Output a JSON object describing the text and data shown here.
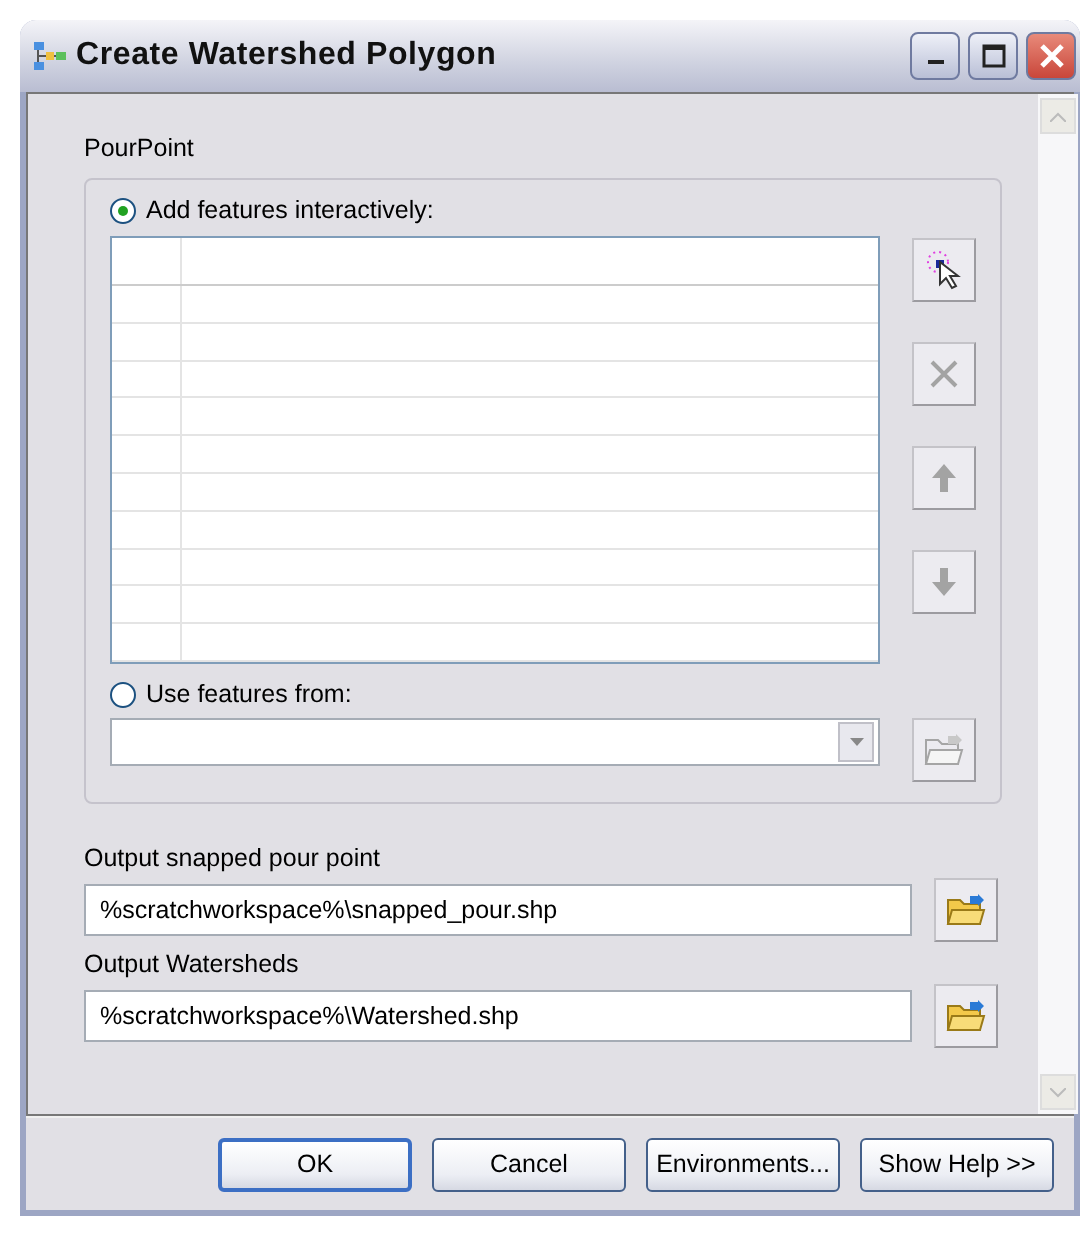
{
  "window": {
    "title": "Create Watershed Polygon"
  },
  "pour_point": {
    "label": "PourPoint",
    "sources": [
      {
        "label": "Add features interactively:",
        "selected": true
      },
      {
        "label": "Use features from:",
        "selected": false
      }
    ],
    "tools": [
      {
        "kind": "add",
        "disabled": false
      },
      {
        "kind": "delete",
        "disabled": true
      },
      {
        "kind": "up",
        "disabled": true
      },
      {
        "kind": "down",
        "disabled": true
      }
    ],
    "browse": {
      "disabled": true
    }
  },
  "outputs": [
    {
      "label": "Output snapped pour point",
      "value": "%scratchworkspace%\\snapped_pour.shp"
    },
    {
      "label": "Output Watersheds",
      "value": "%scratchworkspace%\\Watershed.shp"
    }
  ],
  "buttons": [
    {
      "label": "OK",
      "default": true
    },
    {
      "label": "Cancel",
      "default": false
    },
    {
      "label": "Environments...",
      "default": false
    },
    {
      "label": "Show Help >>",
      "default": false
    }
  ]
}
